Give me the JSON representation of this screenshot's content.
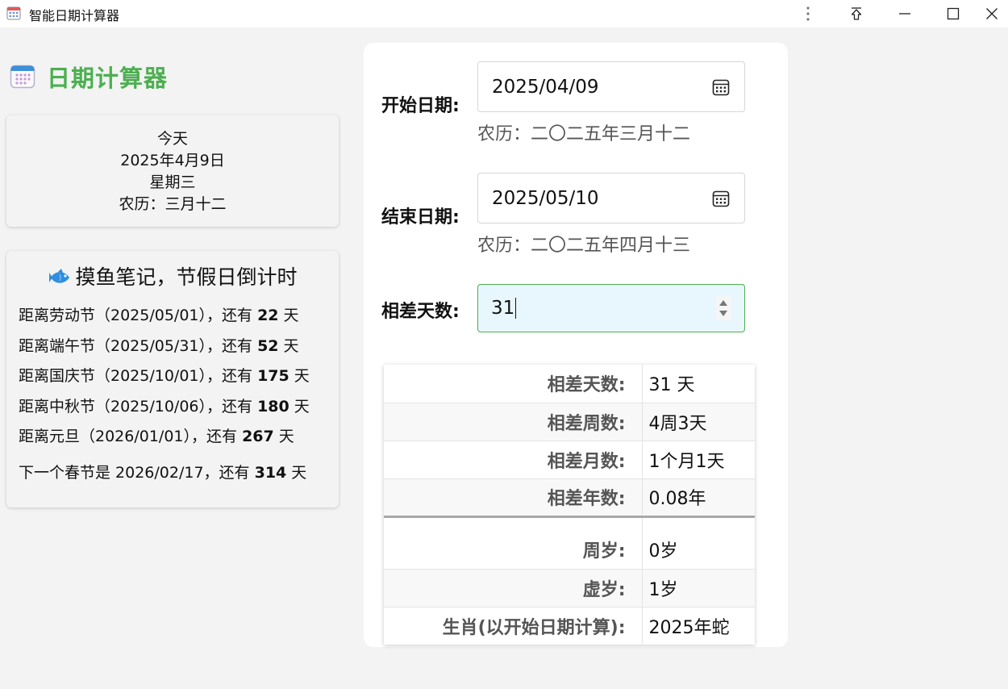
{
  "window": {
    "title": "智能日期计算器"
  },
  "sidebar": {
    "brand_title": "日期计算器",
    "today": {
      "label": "今天",
      "date": "2025年4月9日",
      "weekday": "星期三",
      "lunar": "农历：三月十二"
    },
    "holidays": {
      "title": "摸鱼笔记，节假日倒计时",
      "items": [
        {
          "prefix": "距离劳动节（2025/05/01），还有 ",
          "days": "22",
          "suffix": " 天"
        },
        {
          "prefix": "距离端午节（2025/05/31），还有 ",
          "days": "52",
          "suffix": " 天"
        },
        {
          "prefix": "距离国庆节（2025/10/01），还有 ",
          "days": "175",
          "suffix": " 天"
        },
        {
          "prefix": "距离中秋节（2025/10/06），还有 ",
          "days": "180",
          "suffix": " 天"
        },
        {
          "prefix": "距离元旦（2026/01/01），还有 ",
          "days": "267",
          "suffix": " 天"
        }
      ],
      "spring": {
        "prefix": "下一个春节是 2026/02/17，还有 ",
        "days": "314",
        "suffix": " 天"
      }
    }
  },
  "form": {
    "start_label": "开始日期:",
    "start_value": "2025/04/09",
    "start_lunar": "农历：二〇二五年三月十二",
    "end_label": "结束日期:",
    "end_value": "2025/05/10",
    "end_lunar": "农历：二〇二五年四月十三",
    "diff_label": "相差天数:",
    "diff_value": "31"
  },
  "results": {
    "days_label": "相差天数:",
    "days_value": "31 天",
    "weeks_label": "相差周数:",
    "weeks_value": "4周3天",
    "months_label": "相差月数:",
    "months_value": "1个月1天",
    "years_label": "相差年数:",
    "years_value": "0.08年",
    "age_label": "周岁:",
    "age_value": "0岁",
    "nominal_age_label": "虚岁:",
    "nominal_age_value": "1岁",
    "zodiac_label": "生肖(以开始日期计算):",
    "zodiac_value": "2025年蛇"
  },
  "colors": {
    "accent": "#4caf50",
    "input_focus_bg": "#e8f6fd"
  }
}
